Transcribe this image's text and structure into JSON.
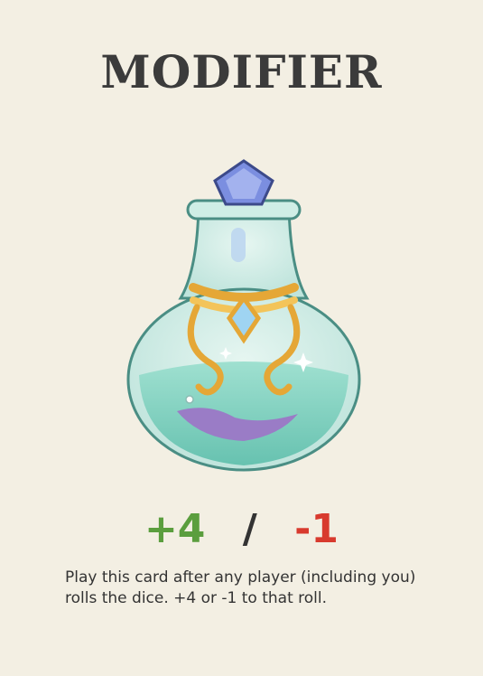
{
  "card": {
    "title": "MODIFIER",
    "illustration_icon": "potion-bottle-icon",
    "modifier_plus": "+4",
    "separator": "/",
    "modifier_minus": "-1",
    "description": "Play this card after any player (including you) rolls the dice. +4 or -1 to that roll.",
    "colors": {
      "background": "#f3efe3",
      "title": "#3b3b3b",
      "plus": "#5b9e3e",
      "minus": "#d83a2e"
    }
  }
}
